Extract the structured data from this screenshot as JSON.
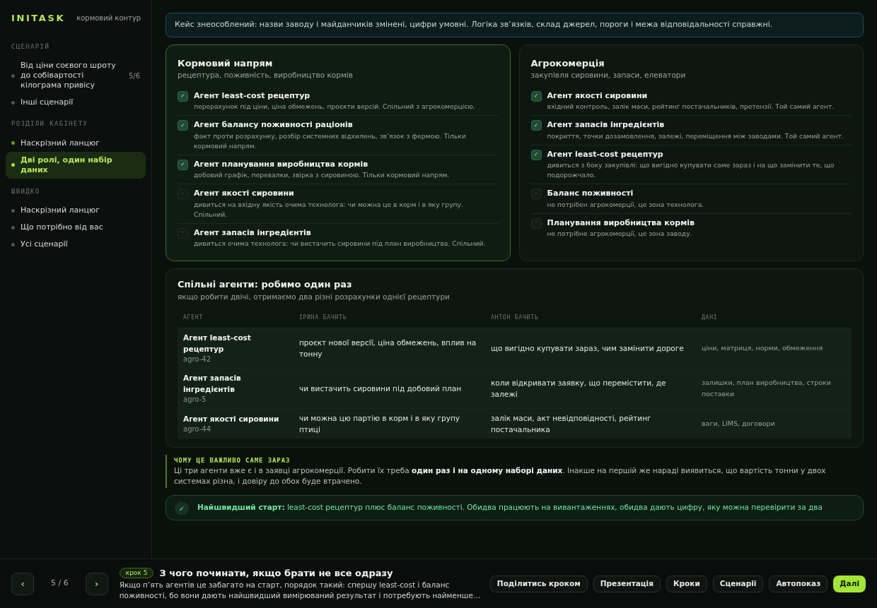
{
  "brand": {
    "logo": "INITASK",
    "subtitle": "кормовий контур"
  },
  "sidebar": {
    "sections": [
      {
        "title": "СЦЕНАРІЙ",
        "items": [
          {
            "label": "Від ціни соєвого шроту до собівартості кілограма привісу",
            "count": "5/6",
            "selected": false,
            "color": "#4b5563"
          },
          {
            "label": "Інші сценарії",
            "selected": false,
            "color": "#4b5563"
          }
        ]
      },
      {
        "title": "РОЗДІЛИ КАБІНЕТУ",
        "items": [
          {
            "label": "Наскрізний ланцюг",
            "selected": false,
            "color": "#65a30d"
          },
          {
            "label": "Дві ролі, один набір даних",
            "selected": true,
            "color": "#a3e635"
          }
        ]
      },
      {
        "title": "ШВИДКО",
        "items": [
          {
            "label": "Наскрізний ланцюг",
            "selected": false,
            "color": "#4b5563"
          },
          {
            "label": "Що потрібно від вас",
            "selected": false,
            "color": "#4b5563"
          },
          {
            "label": "Усі сценарії",
            "selected": false,
            "color": "#4b5563"
          }
        ]
      }
    ]
  },
  "notice": "Кейс знеособлений: назви заводу і майданчиків змінені, цифри умовні. Логіка зв’язків, склад джерел, пороги і межа відповідальності справжні.",
  "roles": [
    {
      "title": "Кормовий напрям",
      "subtitle": "рецептура, поживність, виробництво кормів",
      "highlighted": true,
      "agents": [
        {
          "name": "Агент least-cost рецептур",
          "desc": "перерахунок під ціни, ціна обмежень, проєкти версій. Спільний з агрокомерцією.",
          "checked": true,
          "mark": "✓"
        },
        {
          "name": "Агент балансу поживності раціонів",
          "desc": "факт проти розрахунку, розбір системних відхилень, зв’язок з фермою. Тільки кормовий напрям.",
          "checked": true,
          "mark": "✓"
        },
        {
          "name": "Агент планування виробництва кормів",
          "desc": "добовий графік, перевалки, звірка з сировиною. Тільки кормовий напрям.",
          "checked": true,
          "mark": "✓"
        },
        {
          "name": "Агент якості сировини",
          "desc": "дивиться на вхідну якість очима технолога: чи можна це в корм і в яку групу. Спільний.",
          "checked": false,
          "mark": "·"
        },
        {
          "name": "Агент запасів інгредієнтів",
          "desc": "дивиться очима технолога: чи вистачить сировини під план виробництва. Спільний.",
          "checked": false,
          "mark": "·"
        }
      ]
    },
    {
      "title": "Агрокомерція",
      "subtitle": "закупівля сировини, запаси, елеватори",
      "highlighted": false,
      "agents": [
        {
          "name": "Агент якості сировини",
          "desc": "вхідний контроль, залік маси, рейтинг постачальників, претензії. Той самий агент.",
          "checked": true,
          "mark": "✓"
        },
        {
          "name": "Агент запасів інгредієнтів",
          "desc": "покриття, точки дозамовлення, залежі, переміщення між заводами. Той самий агент.",
          "checked": true,
          "mark": "✓"
        },
        {
          "name": "Агент least-cost рецептур",
          "desc": "дивиться з боку закупівлі: що вигідно купувати саме зараз і на що замінити те, що подорожчало.",
          "checked": true,
          "mark": "✓"
        },
        {
          "name": "Баланс поживності",
          "desc": "не потрібен агрокомерції, це зона технолога.",
          "checked": false,
          "mark": "·"
        },
        {
          "name": "Планування виробництва кормів",
          "desc": "не потрібне агрокомерції, це зона заводу.",
          "checked": false,
          "mark": "·"
        }
      ]
    }
  ],
  "shared": {
    "title": "Спільні агенти: робимо один раз",
    "subtitle": "якщо робити двічі, отримаємо два різні розрахунки однієї рецептури",
    "table": {
      "columns": [
        "АГЕНТ",
        "ІРИНА БАЧИТЬ",
        "АНТОН БАЧИТЬ",
        "ДАНІ"
      ],
      "rows": [
        {
          "code": "agro-42",
          "cells": [
            "Агент least-cost рецептур",
            "проєкт нової версії, ціна обмежень, вплив на тонну",
            "що вигідно купувати зараз, чим замінити дороге",
            "ціни, матриця, норми, обмеження"
          ]
        },
        {
          "code": "agro-5",
          "cells": [
            "Агент запасів інгредієнтів",
            "чи вистачить сировини під добовий план",
            "коли відкривати заявку, що перемістити, де залежі",
            "залишки, план виробництва, строки поставки"
          ]
        },
        {
          "code": "agro-44",
          "cells": [
            "Агент якості сировини",
            "чи можна цю партію в корм і в яку групу птиці",
            "залік маси, акт невідповідності, рейтинг постачальника",
            "ваги, LIMS, договори"
          ]
        }
      ]
    }
  },
  "why": {
    "title": "ЧОМУ ЦЕ ВАЖЛИВО САМЕ ЗАРАЗ",
    "text": "Ці три агенти вже є і в заявці агрокомерції. Робити їх треба **один раз і на одному наборі даних**. Інакше на першій же нараді виявиться, що вартість тонни у двох системах різна, і довіру до обох буде втрачено."
  },
  "tip": {
    "mark": "✓",
    "lead": "Найшвидший старт:",
    "text": "least-cost рецептур плюс баланс поживності. Обидва працюють на вивантаженнях, обидва дають цифру, яку можна перевірити за два"
  },
  "footer": {
    "prev": "‹",
    "next": "›",
    "position": "5 / 6",
    "step_badge": "крок 5",
    "step_title": "З чого починати, якщо брати не все одразу",
    "step_text": "Якщо п’ять агентів це забагато на старт, порядок такий: спершу least-cost і баланс поживності, бо вони дають найшвидший вимірюваний результат і потребують найменше…",
    "buttons": [
      {
        "label": "Поділитись кроком",
        "primary": false
      },
      {
        "label": "Презентація",
        "primary": false
      },
      {
        "label": "Кроки",
        "primary": false
      },
      {
        "label": "Сценарії",
        "primary": false
      },
      {
        "label": "Автопоказ",
        "primary": false
      },
      {
        "label": "Далі",
        "primary": true
      }
    ]
  }
}
